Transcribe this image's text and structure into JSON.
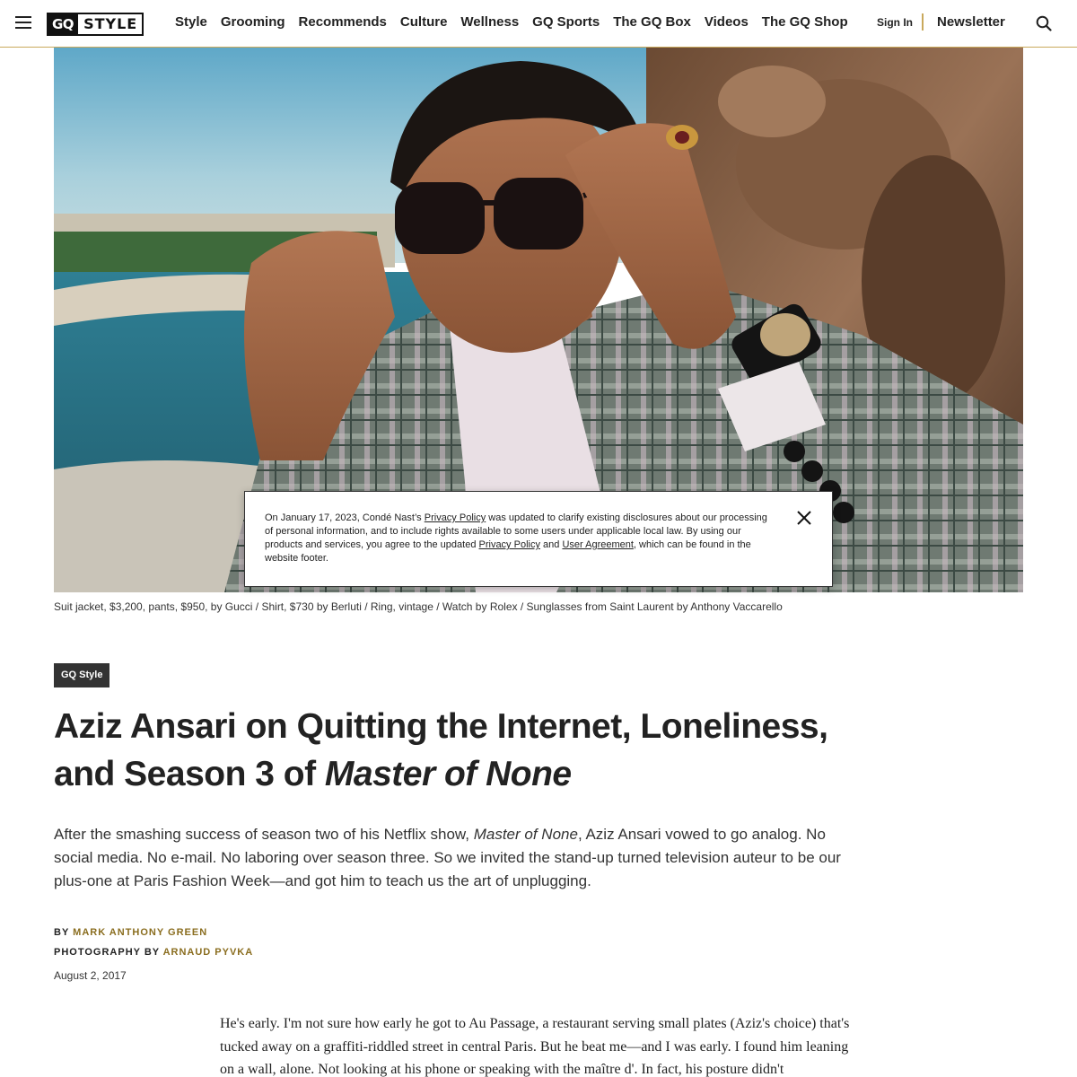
{
  "header": {
    "logo_gq": "GQ",
    "logo_style": "STYLE",
    "nav": [
      "Style",
      "Grooming",
      "Recommends",
      "Culture",
      "Wellness",
      "GQ Sports",
      "The GQ Box",
      "Videos",
      "The GQ Shop"
    ],
    "sign_in": "Sign In",
    "newsletter": "Newsletter"
  },
  "privacy_notice": {
    "text_1": "On January 17, 2023, Condé Nast’s ",
    "link_1": "Privacy Policy",
    "text_2": " was updated to clarify existing disclosures about our processing of personal information, and to include rights available to some users under applicable local law. By using our products and services, you agree to the updated ",
    "link_2": "Privacy Policy",
    "text_3": " and ",
    "link_3": "User Agreement",
    "text_4": ", which can be found in the website footer."
  },
  "hero": {
    "caption": "Suit jacket, $3,200, pants, $950, by Gucci / Shirt, $730 by Berluti / Ring, vintage / Watch by Rolex / Sunglasses from Saint Laurent by Anthony Vaccarello"
  },
  "article": {
    "rubric": "GQ Style",
    "headline_plain": "Aziz Ansari on Quitting the Internet, Loneliness, and Season 3 of ",
    "headline_italic": "Master of None",
    "dek_1": "After the smashing success of season two of his Netflix show, ",
    "dek_italic": "Master of None",
    "dek_2": ", Aziz Ansari vowed to go analog. No social media. No e-mail. No laboring over season three. So we invited the stand-up turned television auteur to be our plus-one at Paris Fashion Week—and got him to teach us the art of unplugging.",
    "by_label": "BY",
    "author": "MARK ANTHONY GREEN",
    "photo_label": "PHOTOGRAPHY BY",
    "photographer": "ARNAUD PYVKA",
    "date": "August 2, 2017",
    "body": "He's early. I'm not sure how early he got to Au Passage, a restaurant serving small plates (Aziz's choice) that's tucked away on a graffiti-riddled street in central Paris. But he beat me—and I was early. I found him leaning on a wall, alone. Not looking at his phone or speaking with the maître d'. In fact, his posture didn't"
  }
}
